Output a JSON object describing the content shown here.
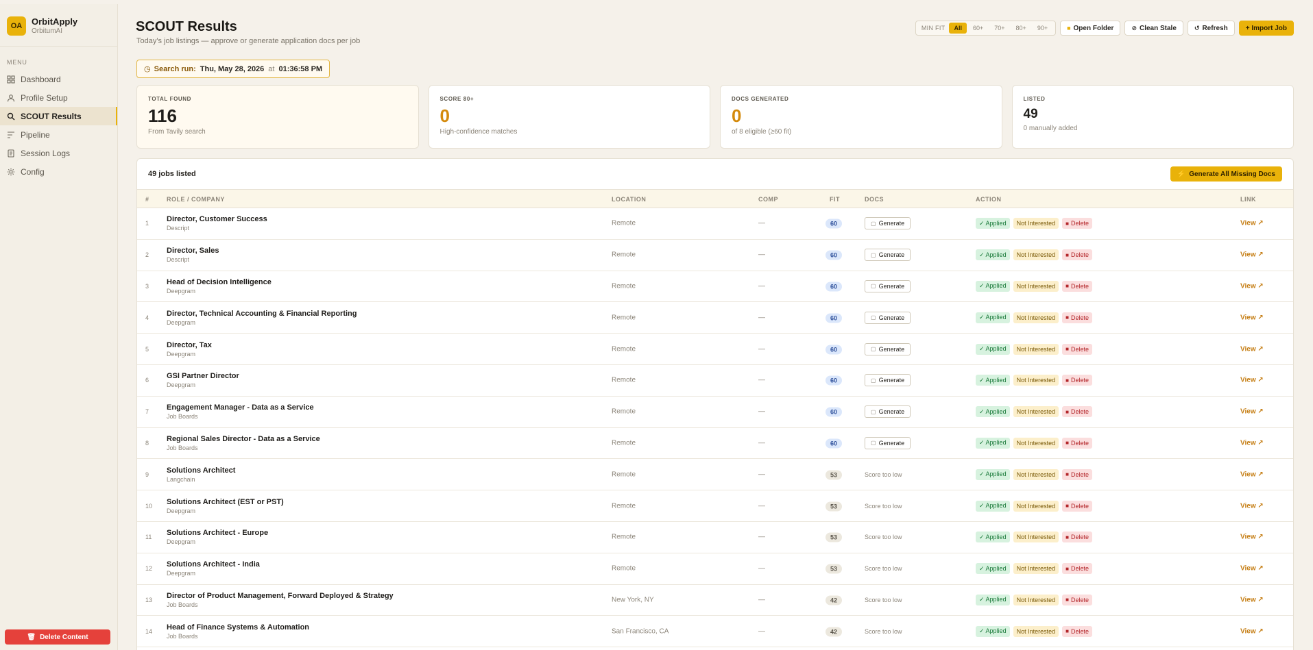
{
  "app": {
    "logo_initials": "OA",
    "name": "OrbitApply",
    "subtitle": "OrbitumAI"
  },
  "sidebar": {
    "menu_label": "MENU",
    "items": [
      {
        "label": "Dashboard",
        "icon": "grid-icon"
      },
      {
        "label": "Profile Setup",
        "icon": "user-icon"
      },
      {
        "label": "SCOUT Results",
        "icon": "search-icon",
        "active": true
      },
      {
        "label": "Pipeline",
        "icon": "pipeline-icon"
      },
      {
        "label": "Session Logs",
        "icon": "document-icon"
      },
      {
        "label": "Config",
        "icon": "gear-icon"
      }
    ],
    "delete_label": "Delete Content"
  },
  "header": {
    "title": "SCOUT Results",
    "subtitle": "Today's job listings — approve or generate application docs per job"
  },
  "toolbar": {
    "min_fit_label": "MIN FIT",
    "min_fit_options": [
      "All",
      "60+",
      "70+",
      "80+",
      "90+"
    ],
    "min_fit_selected": "All",
    "open_folder": "Open Folder",
    "clean_stale": "Clean Stale",
    "refresh": "Refresh",
    "import_job": "+ Import Job"
  },
  "search_run": {
    "label": "Search run:",
    "date": "Thu, May 28, 2026",
    "at": "at",
    "time": "01:36:58 PM"
  },
  "stats": [
    {
      "label": "TOTAL FOUND",
      "value": "116",
      "note": "From Tavily search"
    },
    {
      "label": "SCORE 80+",
      "value": "0",
      "note": "High-confidence matches"
    },
    {
      "label": "DOCS GENERATED",
      "value": "0",
      "note": "of 8 eligible (≥60 fit)"
    },
    {
      "label": "LISTED",
      "value": "49",
      "note": "0 manually added"
    }
  ],
  "table": {
    "count_label": "49 jobs listed",
    "generate_all": "Generate All Missing Docs",
    "columns": {
      "num": "#",
      "role": "ROLE / COMPANY",
      "location": "LOCATION",
      "comp": "COMP",
      "fit": "FIT",
      "docs": "DOCS",
      "action": "ACTION",
      "link": "LINK"
    },
    "labels": {
      "generate": "Generate",
      "score_low": "Score too low",
      "applied": "✓ Applied",
      "not_interested": "Not Interested",
      "delete": "Delete",
      "view": "View ↗"
    },
    "rows": [
      {
        "num": "1",
        "title": "Director, Customer Success",
        "company": "Descript",
        "location": "Remote",
        "comp": "—",
        "fit": "60"
      },
      {
        "num": "2",
        "title": "Director, Sales",
        "company": "Descript",
        "location": "Remote",
        "comp": "—",
        "fit": "60"
      },
      {
        "num": "3",
        "title": "Head of Decision Intelligence",
        "company": "Deepgram",
        "location": "Remote",
        "comp": "—",
        "fit": "60"
      },
      {
        "num": "4",
        "title": "Director, Technical Accounting & Financial Reporting",
        "company": "Deepgram",
        "location": "Remote",
        "comp": "—",
        "fit": "60"
      },
      {
        "num": "5",
        "title": "Director, Tax",
        "company": "Deepgram",
        "location": "Remote",
        "comp": "—",
        "fit": "60"
      },
      {
        "num": "6",
        "title": "GSI Partner Director",
        "company": "Deepgram",
        "location": "Remote",
        "comp": "—",
        "fit": "60"
      },
      {
        "num": "7",
        "title": "Engagement Manager - Data as a Service",
        "company": "Job Boards",
        "location": "Remote",
        "comp": "—",
        "fit": "60"
      },
      {
        "num": "8",
        "title": "Regional Sales Director - Data as a Service",
        "company": "Job Boards",
        "location": "Remote",
        "comp": "—",
        "fit": "60"
      },
      {
        "num": "9",
        "title": "Solutions Architect",
        "company": "Langchain",
        "location": "Remote",
        "comp": "—",
        "fit": "53"
      },
      {
        "num": "10",
        "title": "Solutions Architect (EST or PST)",
        "company": "Deepgram",
        "location": "Remote",
        "comp": "—",
        "fit": "53"
      },
      {
        "num": "11",
        "title": "Solutions Architect - Europe",
        "company": "Deepgram",
        "location": "Remote",
        "comp": "—",
        "fit": "53"
      },
      {
        "num": "12",
        "title": "Solutions Architect - India",
        "company": "Deepgram",
        "location": "Remote",
        "comp": "—",
        "fit": "53"
      },
      {
        "num": "13",
        "title": "Director of Product Management, Forward Deployed & Strategy",
        "company": "Job Boards",
        "location": "New York, NY",
        "comp": "—",
        "fit": "42"
      },
      {
        "num": "14",
        "title": "Head of Finance Systems & Automation",
        "company": "Job Boards",
        "location": "San Francisco, CA",
        "comp": "—",
        "fit": "42"
      }
    ]
  }
}
